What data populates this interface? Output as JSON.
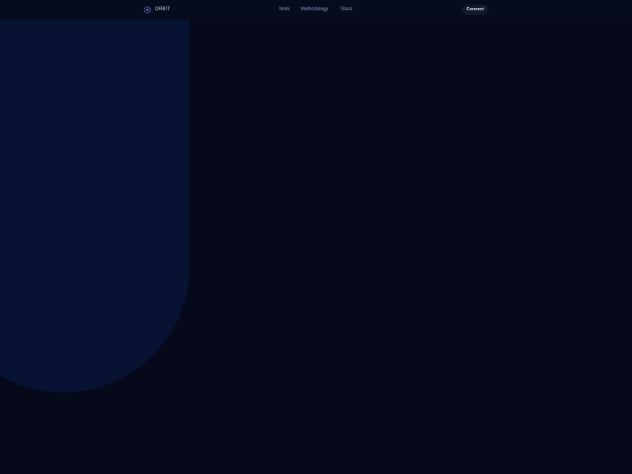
{
  "header": {
    "brand": {
      "name": "ORBIT",
      "icon": "orbit-logo-icon"
    },
    "nav": [
      {
        "label": "Work"
      },
      {
        "label": "Methodology"
      },
      {
        "label": "Stack"
      }
    ],
    "cta_label": "Connect"
  },
  "colors": {
    "background": "#050919",
    "topbar": "#060b1e",
    "hero_shape": "#081233",
    "nav_text": "#8f98b6",
    "cta_bg": "#141a2c",
    "accent": "#5b66d6"
  }
}
